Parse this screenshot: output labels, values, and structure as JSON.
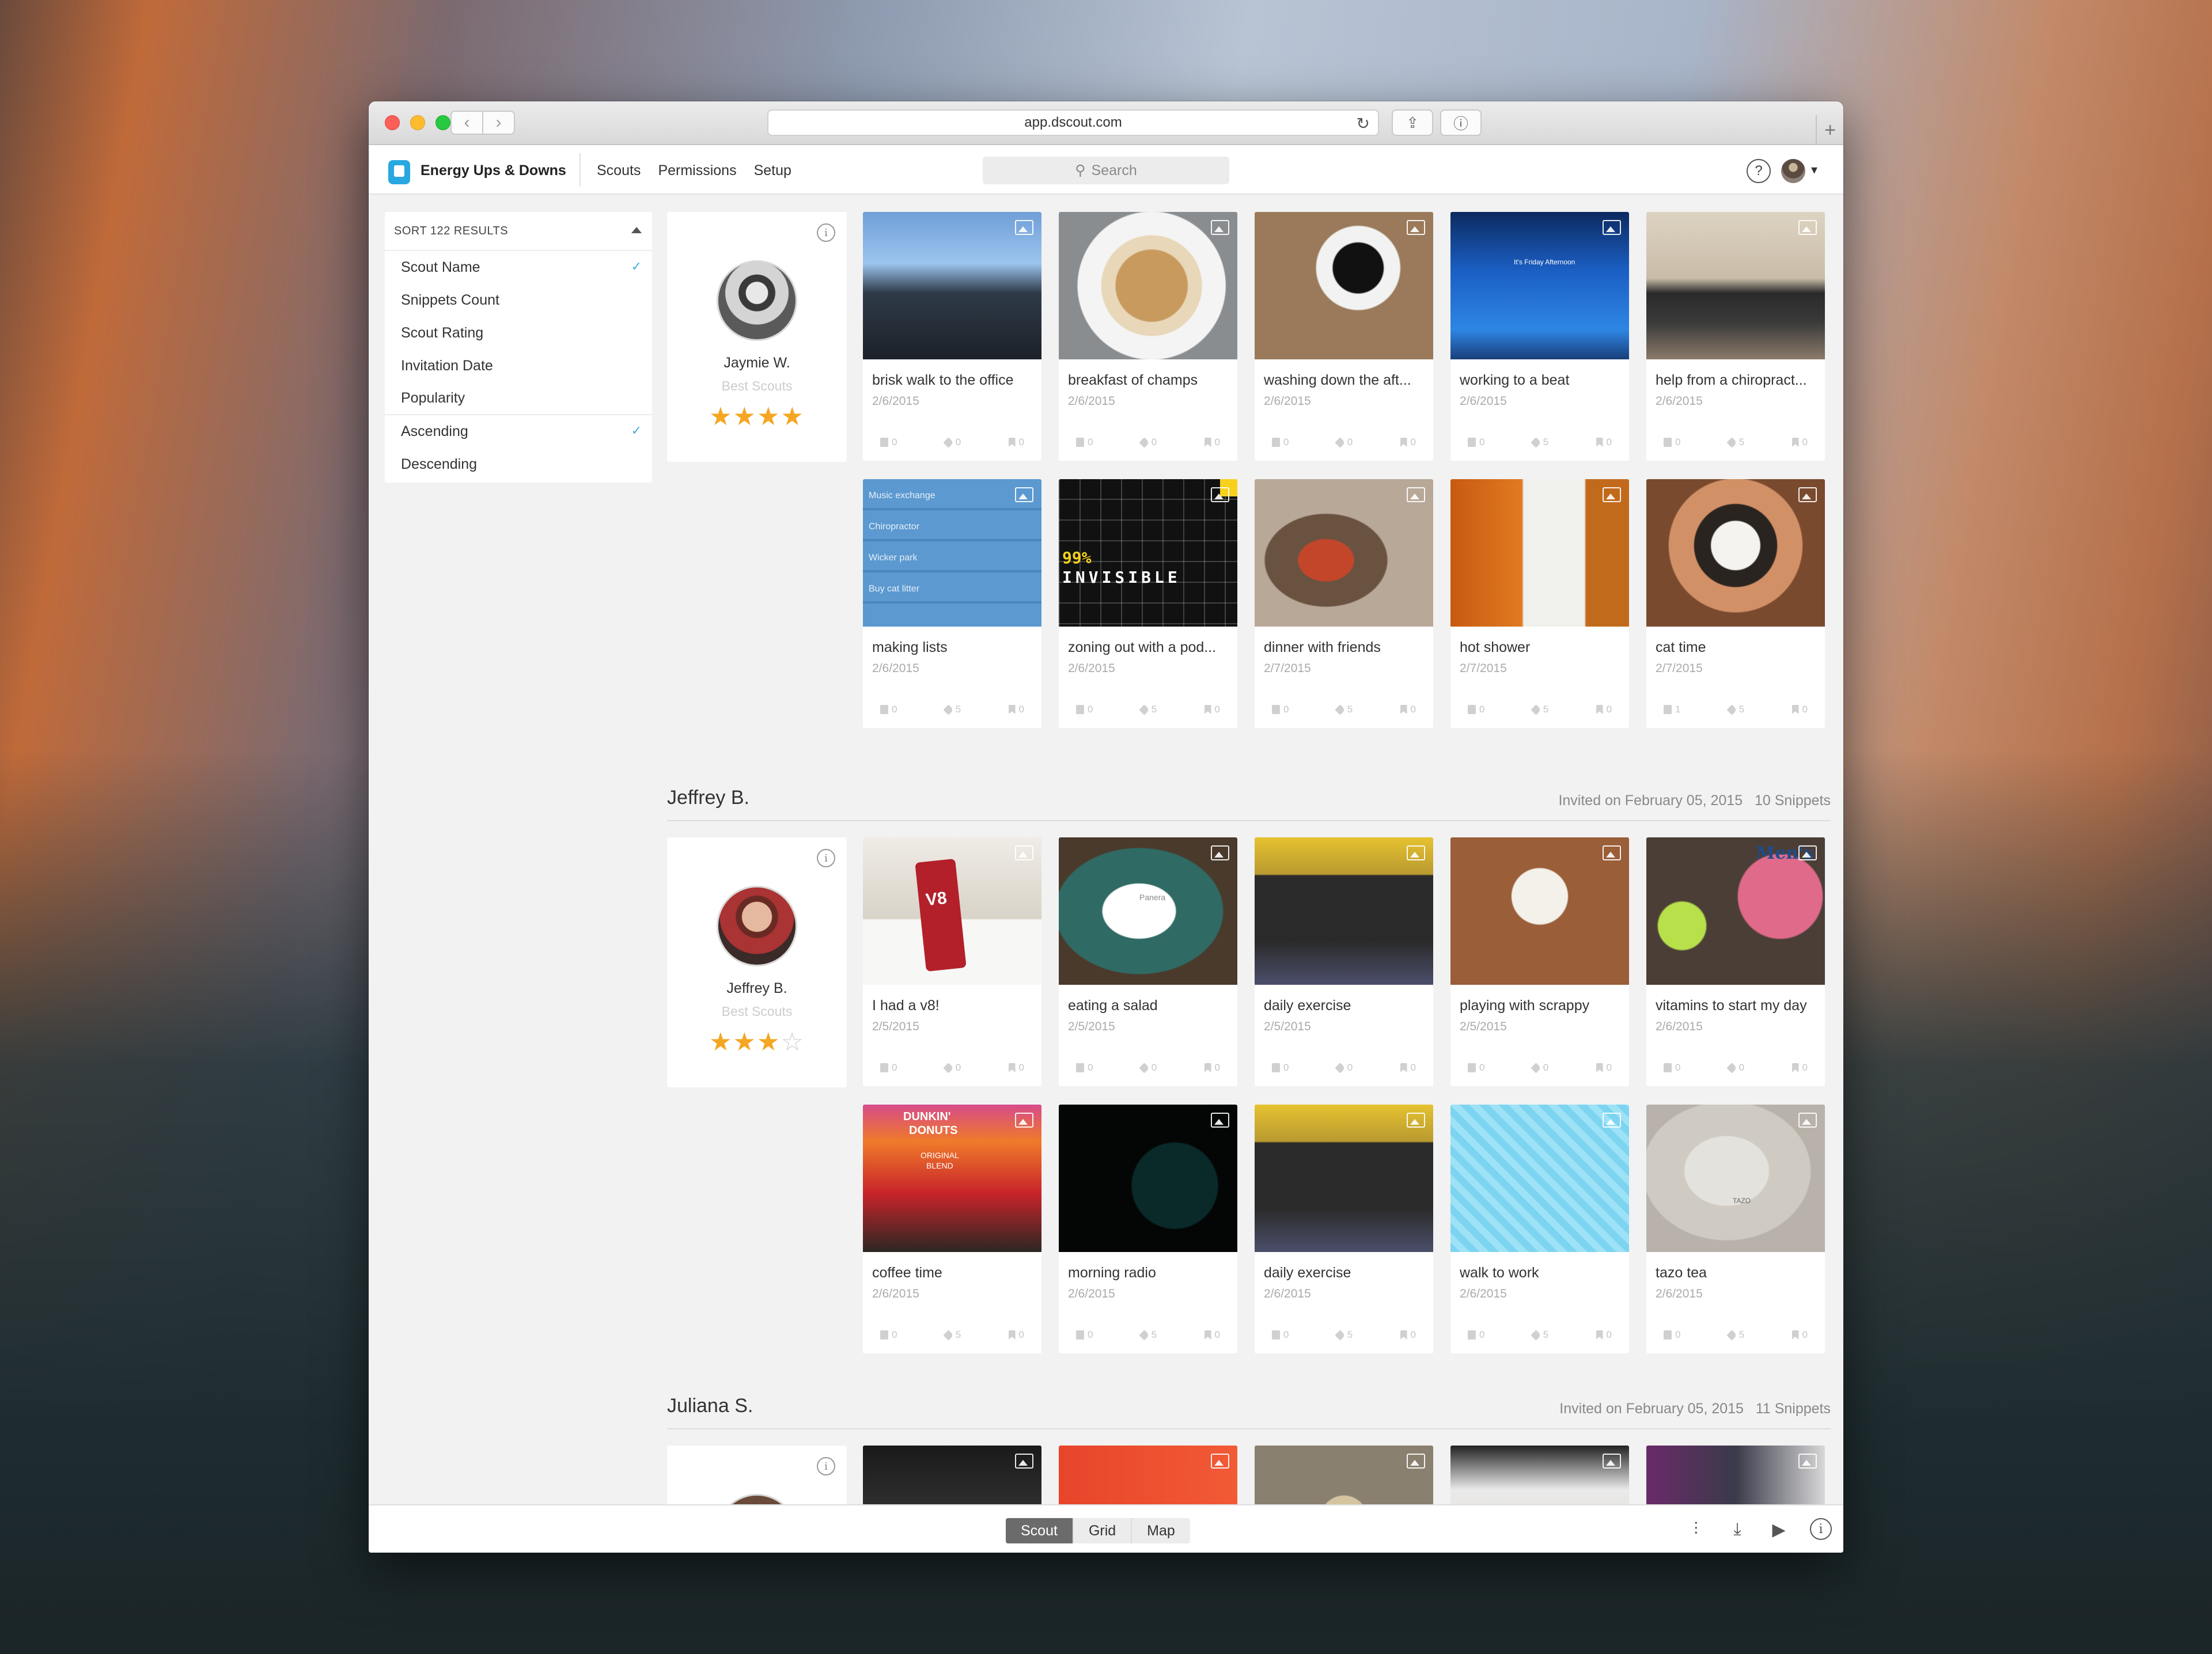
{
  "browser": {
    "url": "app.dscout.com"
  },
  "header": {
    "project_title": "Energy Ups & Downs",
    "nav": [
      "Scouts",
      "Permissions",
      "Setup"
    ],
    "search_placeholder": "Search",
    "help_label": "?"
  },
  "sort": {
    "heading": "SORT 122 RESULTS",
    "options": [
      {
        "label": "Scout Name",
        "checked": true
      },
      {
        "label": "Snippets Count",
        "checked": false
      },
      {
        "label": "Scout Rating",
        "checked": false
      },
      {
        "label": "Invitation Date",
        "checked": false
      },
      {
        "label": "Popularity",
        "checked": false
      }
    ],
    "order": [
      {
        "label": "Ascending",
        "checked": true
      },
      {
        "label": "Descending",
        "checked": false
      }
    ]
  },
  "scouts": [
    {
      "name": "Jaymie W.",
      "subtitle": "Best Scouts",
      "rating": 4,
      "snippets": [
        {
          "title": "brisk walk to the office",
          "date": "2/6/2015",
          "counts": [
            "0",
            "0",
            "0"
          ],
          "thumb": "city"
        },
        {
          "title": "breakfast of champs",
          "date": "2/6/2015",
          "counts": [
            "0",
            "0",
            "0"
          ],
          "thumb": "oatmeal"
        },
        {
          "title": "washing down the aft...",
          "date": "2/6/2015",
          "counts": [
            "0",
            "0",
            "0"
          ],
          "thumb": "coffee"
        },
        {
          "title": "working to a beat",
          "date": "2/6/2015",
          "counts": [
            "0",
            "5",
            "0"
          ],
          "thumb": "screen"
        },
        {
          "title": "help from a chiropract...",
          "date": "2/6/2015",
          "counts": [
            "0",
            "5",
            "0"
          ],
          "thumb": "office"
        },
        {
          "title": "making lists",
          "date": "2/6/2015",
          "counts": [
            "0",
            "5",
            "0"
          ],
          "thumb": "lists"
        },
        {
          "title": "zoning out with a pod...",
          "date": "2/6/2015",
          "counts": [
            "0",
            "5",
            "0"
          ],
          "thumb": "podcast"
        },
        {
          "title": "dinner with friends",
          "date": "2/7/2015",
          "counts": [
            "0",
            "5",
            "0"
          ],
          "thumb": "dinner"
        },
        {
          "title": "hot shower",
          "date": "2/7/2015",
          "counts": [
            "0",
            "5",
            "0"
          ],
          "thumb": "shower"
        },
        {
          "title": "cat time",
          "date": "2/7/2015",
          "counts": [
            "1",
            "5",
            "0"
          ],
          "thumb": "cat"
        }
      ],
      "list_texts": [
        "Music exchange",
        "Chiropractor",
        "Wicker park",
        "Buy cat litter"
      ],
      "podcast_text": [
        "99%",
        "INVISIBLE"
      ],
      "screen_text": "It's Friday Afternoon"
    },
    {
      "name": "Jeffrey B.",
      "subtitle": "Best Scouts",
      "rating": 3,
      "invited": "Invited on February 05, 2015",
      "snippet_count": "10 Snippets",
      "snippets": [
        {
          "title": "I had a v8!",
          "date": "2/5/2015",
          "counts": [
            "0",
            "0",
            "0"
          ],
          "thumb": "v8"
        },
        {
          "title": "eating a salad",
          "date": "2/5/2015",
          "counts": [
            "0",
            "0",
            "0"
          ],
          "thumb": "salad"
        },
        {
          "title": "daily exercise",
          "date": "2/5/2015",
          "counts": [
            "0",
            "0",
            "0"
          ],
          "thumb": "gym"
        },
        {
          "title": "playing with scrappy",
          "date": "2/5/2015",
          "counts": [
            "0",
            "0",
            "0"
          ],
          "thumb": "dog"
        },
        {
          "title": "vitamins to start my day",
          "date": "2/6/2015",
          "counts": [
            "0",
            "0",
            "0"
          ],
          "thumb": "vitamins"
        },
        {
          "title": "coffee time",
          "date": "2/6/2015",
          "counts": [
            "0",
            "5",
            "0"
          ],
          "thumb": "dunkin"
        },
        {
          "title": "morning radio",
          "date": "2/6/2015",
          "counts": [
            "0",
            "5",
            "0"
          ],
          "thumb": "radio"
        },
        {
          "title": "daily exercise",
          "date": "2/6/2015",
          "counts": [
            "0",
            "5",
            "0"
          ],
          "thumb": "gym"
        },
        {
          "title": "walk to work",
          "date": "2/6/2015",
          "counts": [
            "0",
            "5",
            "0"
          ],
          "thumb": "pattern"
        },
        {
          "title": "tazo tea",
          "date": "2/6/2015",
          "counts": [
            "0",
            "5",
            "0"
          ],
          "thumb": "tea"
        }
      ],
      "v8_label": "V8",
      "panera_label": "Panera",
      "mens_label": "Men's",
      "dunkin_label": [
        "DUNKIN'",
        "DONUTS"
      ],
      "dunkin_sub": [
        "ORIGINAL",
        "BLEND"
      ],
      "tazo_label": "TAZO"
    },
    {
      "name": "Juliana S.",
      "invited": "Invited on February 05, 2015",
      "snippet_count": "11 Snippets",
      "thumbs": [
        "kitchen",
        "red",
        "pills",
        "desk",
        "collage"
      ]
    }
  ],
  "footer": {
    "views": [
      {
        "label": "Scout",
        "active": true
      },
      {
        "label": "Grid",
        "active": false
      },
      {
        "label": "Map",
        "active": false
      }
    ]
  },
  "colors": {
    "accent": "#29a8e0",
    "star": "#f5a623",
    "check": "#4aa8dd"
  }
}
